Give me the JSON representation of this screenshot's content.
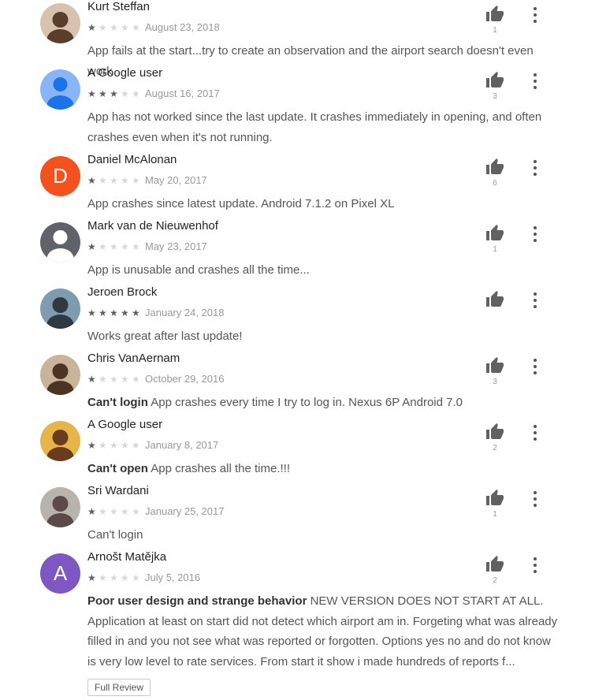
{
  "reviews": [
    {
      "author": "Kurt Steffan",
      "date": "August 23, 2018",
      "rating": 1,
      "likes": "1",
      "title": "",
      "text": "App fails at the start...try to create an observation and the airport search doesn't even work",
      "avatar": {
        "kind": "photo",
        "bg": "#d8c2ad",
        "fg": "#5a3e2b"
      }
    },
    {
      "author": "A Google user",
      "date": "August 16, 2017",
      "rating": 3,
      "likes": "3",
      "title": "",
      "text": "App has not worked since the last update. It crashes immediately in opening, and often crashes even when it's not running.",
      "avatar": {
        "kind": "generic",
        "bg": "#8ab4f8",
        "fg": "#1a73e8"
      }
    },
    {
      "author": "Daniel McAlonan",
      "date": "May 20, 2017",
      "rating": 1,
      "likes": "6",
      "title": "",
      "text": "App crashes since latest update. Android 7.1.2 on Pixel XL",
      "avatar": {
        "kind": "letter",
        "letter": "D",
        "bg": "#f4511e"
      }
    },
    {
      "author": "Mark van de Nieuwenhof",
      "date": "May 23, 2017",
      "rating": 1,
      "likes": "1",
      "title": "",
      "text": "App is unusable and crashes all the time...",
      "avatar": {
        "kind": "generic",
        "bg": "#5f6368",
        "fg": "#ffffff"
      }
    },
    {
      "author": "Jeroen Brock",
      "date": "January 24, 2018",
      "rating": 5,
      "likes": "",
      "title": "",
      "text": "Works great after last update!",
      "avatar": {
        "kind": "photo",
        "bg": "#7f9bb0",
        "fg": "#2e3a40"
      }
    },
    {
      "author": "Chris VanAernam",
      "date": "October 29, 2016",
      "rating": 1,
      "likes": "3",
      "title": "Can't login",
      "text": "App crashes every time I try to log in. Nexus 6P Android 7.0",
      "avatar": {
        "kind": "photo",
        "bg": "#c9b49a",
        "fg": "#4b3424"
      }
    },
    {
      "author": "A Google user",
      "date": "January 8, 2017",
      "rating": 1,
      "likes": "2",
      "title": "Can't open",
      "text": "App crashes all the time.!!!",
      "avatar": {
        "kind": "photo",
        "bg": "#e6b54a",
        "fg": "#6b3b1e"
      }
    },
    {
      "author": "Sri Wardani",
      "date": "January 25, 2017",
      "rating": 1,
      "likes": "1",
      "title": "",
      "text": "Can't login",
      "avatar": {
        "kind": "photo",
        "bg": "#b8b3ad",
        "fg": "#5c4a4a"
      }
    },
    {
      "author": "Arnošt Matějka",
      "date": "July 5, 2016",
      "rating": 1,
      "likes": "2",
      "title": "Poor user design and strange behavior",
      "text": "NEW VERSION DOES NOT START AT ALL. Application at least on start did not detect which airport am in. Forgeting what was already filled in and you not see what was reported or forgotten. Options yes no and do not know is very low level to rate services. From start it show i made hundreds of reports f...",
      "avatar": {
        "kind": "letter",
        "letter": "A",
        "bg": "#7e57c2"
      }
    }
  ],
  "full_review_label": "Full Review",
  "colors": {
    "star_on": "#5f5f5f",
    "star_off": "#d7d7d7",
    "thumb": "#616161"
  }
}
